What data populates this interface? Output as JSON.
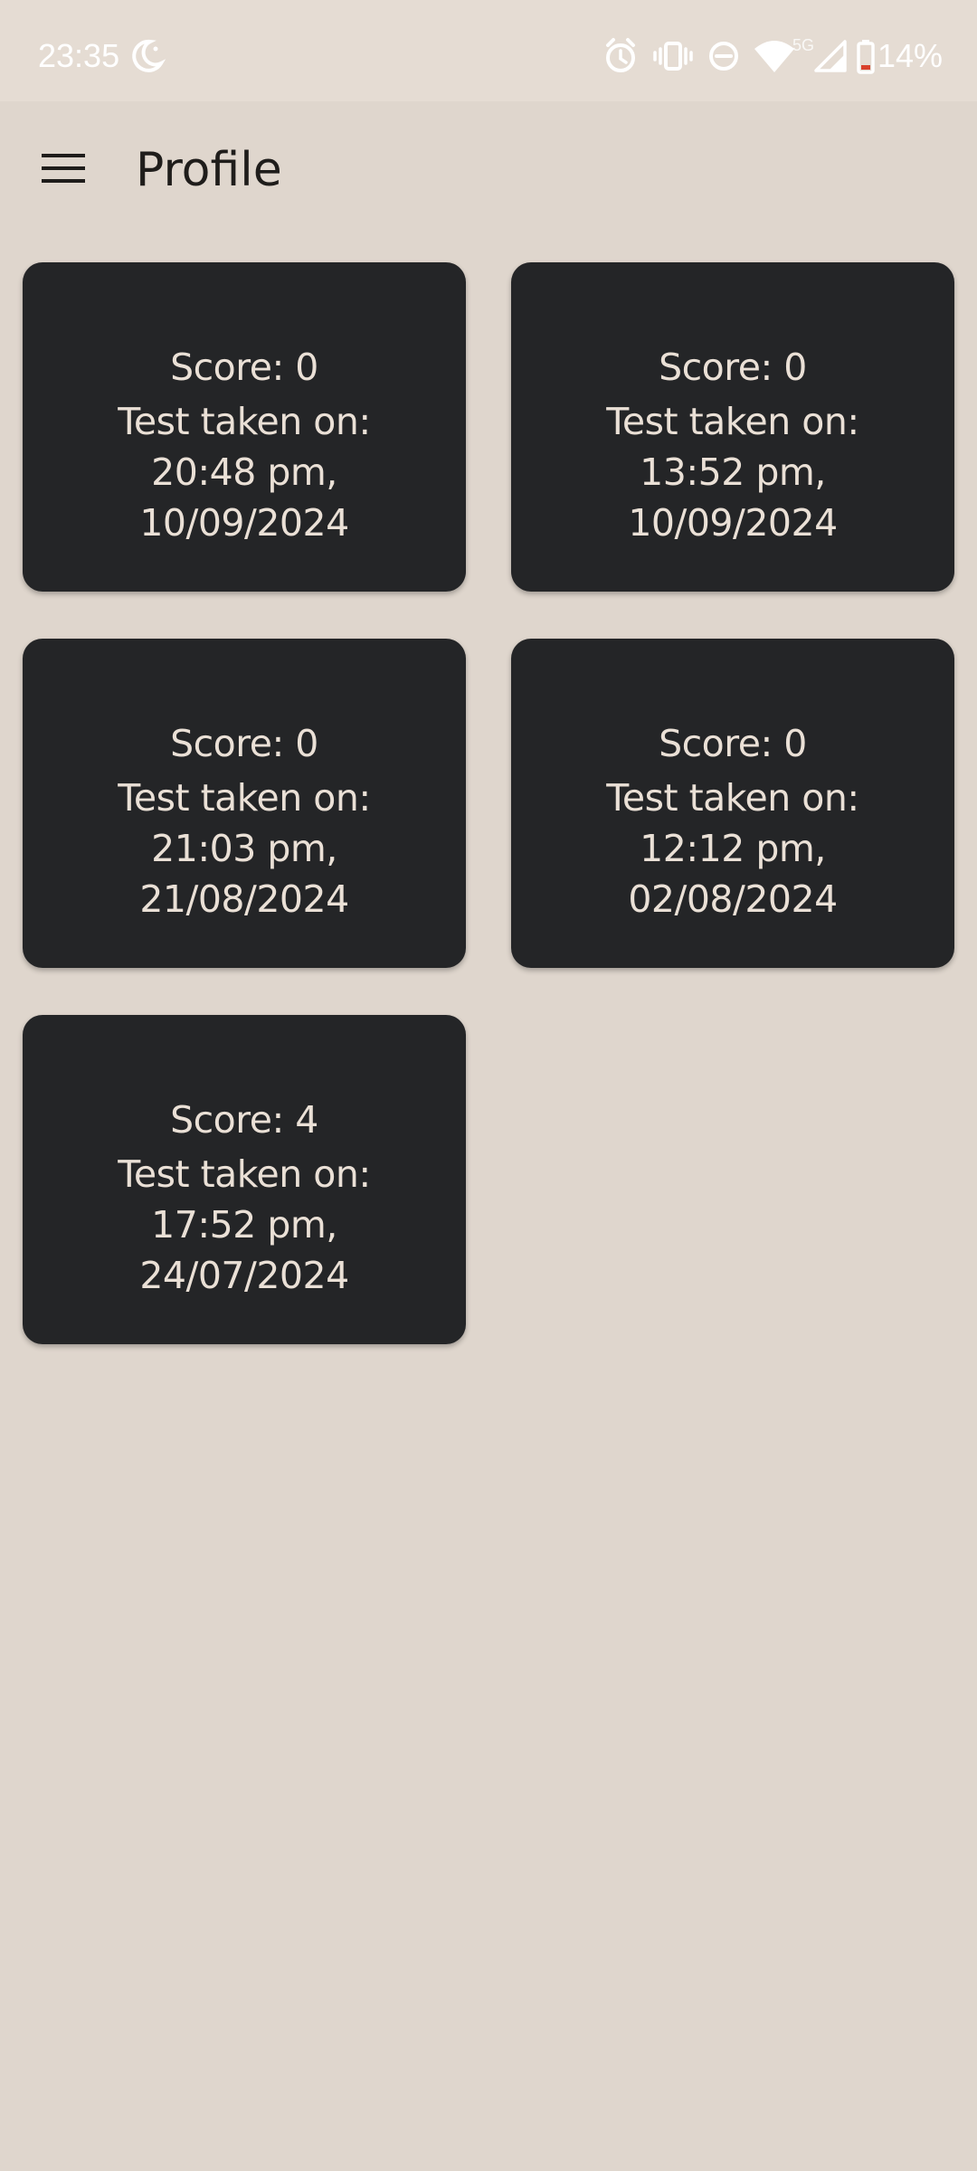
{
  "status_bar": {
    "time": "23:35",
    "battery_percent": "14%",
    "network_label": "5G",
    "icons": [
      "moon-icon",
      "alarm-icon",
      "vibrate-icon",
      "do-not-disturb-icon",
      "wifi-icon",
      "signal-icon",
      "battery-icon"
    ]
  },
  "app_bar": {
    "title": "Profile",
    "menu_icon": "menu-icon"
  },
  "results": [
    {
      "score": "Score: 0",
      "label": "Test taken on:",
      "time": "20:48 pm,",
      "date": "10/09/2024"
    },
    {
      "score": "Score: 0",
      "label": "Test taken on:",
      "time": "13:52 pm,",
      "date": "10/09/2024"
    },
    {
      "score": "Score: 0",
      "label": "Test taken on:",
      "time": "21:03 pm,",
      "date": "21/08/2024"
    },
    {
      "score": "Score: 0",
      "label": "Test taken on:",
      "time": "12:12 pm,",
      "date": "02/08/2024"
    },
    {
      "score": "Score: 4",
      "label": "Test taken on:",
      "time": "17:52 pm,",
      "date": "24/07/2024"
    }
  ],
  "colors": {
    "background": "#dfd6cd",
    "card": "#242527",
    "card_text": "#eae0d6",
    "title_text": "#1f1d1b",
    "battery_low": "#d9412c"
  }
}
